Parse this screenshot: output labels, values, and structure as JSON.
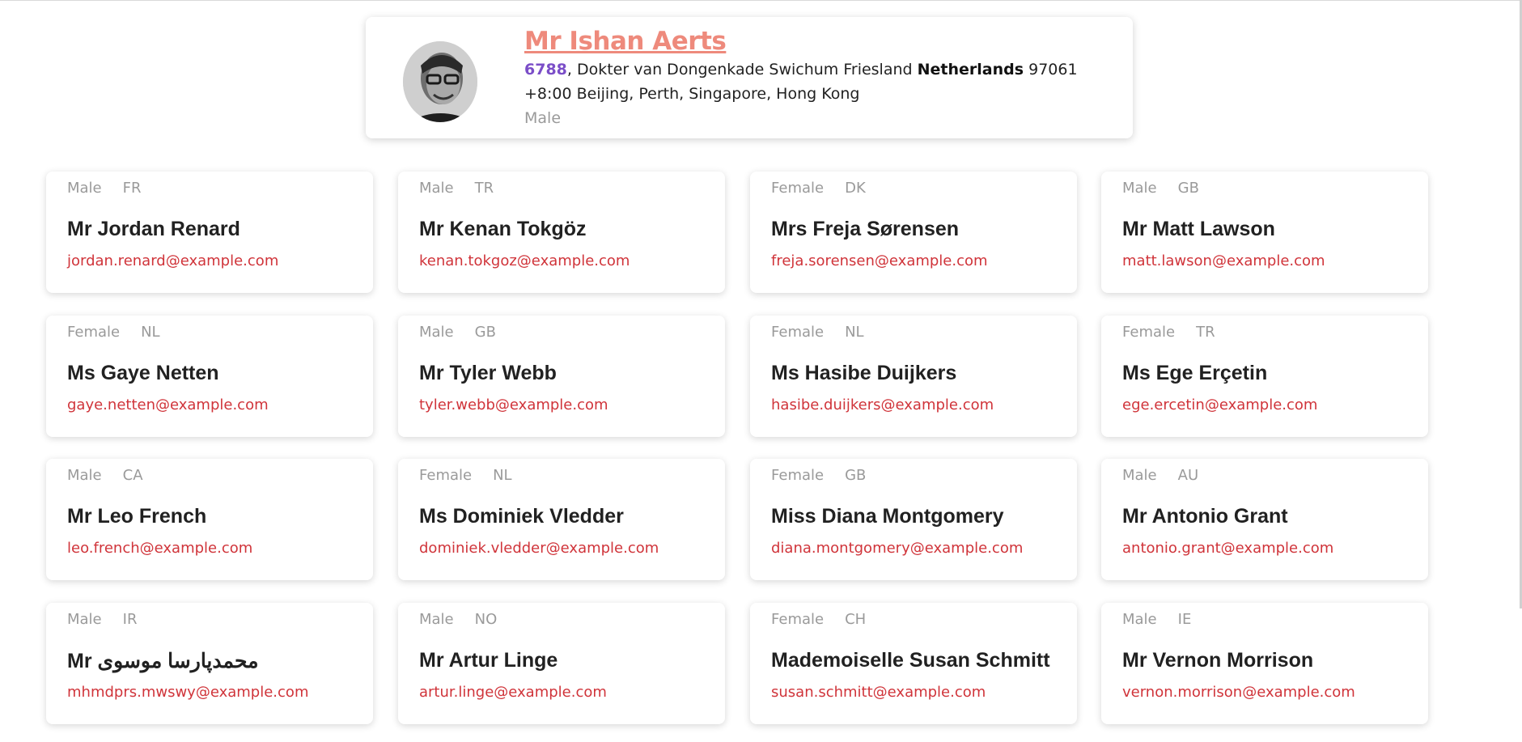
{
  "profile": {
    "name": "Mr Ishan Aerts",
    "street_number": "6788",
    "street_name": ", Dokter van Dongenkade Swichum Friesland ",
    "country": "Netherlands",
    "postcode": " 97061",
    "timezone": "+8:00 Beijing, Perth, Singapore, Hong Kong",
    "gender": "Male"
  },
  "users": [
    {
      "gender": "Male",
      "nat": "FR",
      "name": "Mr Jordan Renard",
      "email": "jordan.renard@example.com"
    },
    {
      "gender": "Male",
      "nat": "TR",
      "name": "Mr Kenan Tokgöz",
      "email": "kenan.tokgoz@example.com"
    },
    {
      "gender": "Female",
      "nat": "DK",
      "name": "Mrs Freja Sørensen",
      "email": "freja.sorensen@example.com"
    },
    {
      "gender": "Male",
      "nat": "GB",
      "name": "Mr Matt Lawson",
      "email": "matt.lawson@example.com"
    },
    {
      "gender": "Female",
      "nat": "NL",
      "name": "Ms Gaye Netten",
      "email": "gaye.netten@example.com"
    },
    {
      "gender": "Male",
      "nat": "GB",
      "name": "Mr Tyler Webb",
      "email": "tyler.webb@example.com"
    },
    {
      "gender": "Female",
      "nat": "NL",
      "name": "Ms Hasibe Duijkers",
      "email": "hasibe.duijkers@example.com"
    },
    {
      "gender": "Female",
      "nat": "TR",
      "name": "Ms Ege Erçetin",
      "email": "ege.ercetin@example.com"
    },
    {
      "gender": "Male",
      "nat": "CA",
      "name": "Mr Leo French",
      "email": "leo.french@example.com"
    },
    {
      "gender": "Female",
      "nat": "NL",
      "name": "Ms Dominiek Vledder",
      "email": "dominiek.vledder@example.com"
    },
    {
      "gender": "Female",
      "nat": "GB",
      "name": "Miss Diana Montgomery",
      "email": "diana.montgomery@example.com"
    },
    {
      "gender": "Male",
      "nat": "AU",
      "name": "Mr Antonio Grant",
      "email": "antonio.grant@example.com"
    },
    {
      "gender": "Male",
      "nat": "IR",
      "name": "Mr محمدپارسا موسوی",
      "email": "mhmdprs.mwswy@example.com"
    },
    {
      "gender": "Male",
      "nat": "NO",
      "name": "Mr Artur Linge",
      "email": "artur.linge@example.com"
    },
    {
      "gender": "Female",
      "nat": "CH",
      "name": "Mademoiselle Susan Schmitt",
      "email": "susan.schmitt@example.com"
    },
    {
      "gender": "Male",
      "nat": "IE",
      "name": "Mr Vernon Morrison",
      "email": "vernon.morrison@example.com"
    }
  ]
}
